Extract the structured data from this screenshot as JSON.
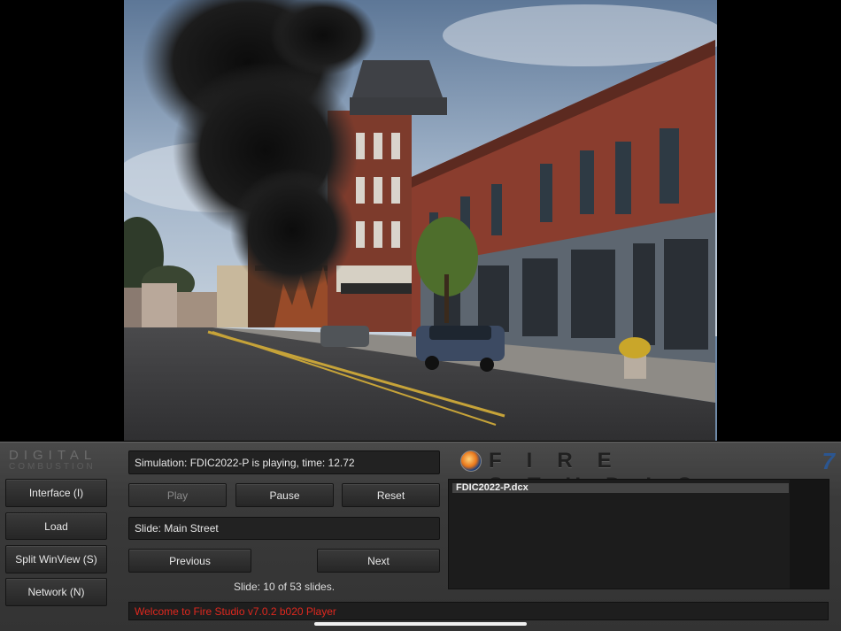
{
  "brand": {
    "digital": "DIGITAL",
    "combustion": "COMBUSTION"
  },
  "sidebar": {
    "buttons": [
      {
        "label": "Interface (I)"
      },
      {
        "label": "Load"
      },
      {
        "label": "Split WinView (S)"
      },
      {
        "label": "Network (N)"
      }
    ]
  },
  "status": {
    "simulation_text": "Simulation: FDIC2022-P is playing, time: 12.72",
    "slide_text": "Slide: Main Street",
    "slide_count": "Slide: 10 of 53 slides.",
    "welcome": "Welcome to Fire Studio v7.0.2 b020 Player"
  },
  "controls": {
    "play": "Play",
    "pause": "Pause",
    "reset": "Reset",
    "previous": "Previous",
    "next": "Next"
  },
  "product": {
    "name": "FIRE STUDIO",
    "version_mark": "7"
  },
  "file_list": {
    "items": [
      "FDIC2022-P.dcx"
    ]
  },
  "colors": {
    "welcome_text": "#e0281e",
    "version_mark": "#2c5690"
  }
}
